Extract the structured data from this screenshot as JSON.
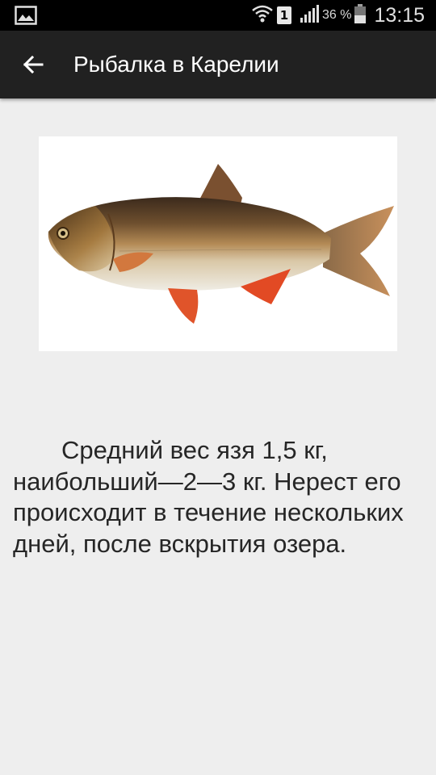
{
  "status_bar": {
    "sim_slot": "1",
    "battery_percent": "36 %",
    "time": "13:15",
    "icons": [
      "gallery-notification-icon",
      "wifi-icon",
      "sim-icon",
      "signal-icon",
      "battery-icon"
    ]
  },
  "app_bar": {
    "title": "Рыбалка в Карелии",
    "back_icon": "arrow-back-icon"
  },
  "content": {
    "image_subject": "fish",
    "description": "Средний вес язя 1,5 кг, наибольший—2—3 кг. Нерест его происходит в течение нескольких дней, после вскрытия озера."
  },
  "colors": {
    "status_bar": "#000000",
    "app_bar": "#212121",
    "background": "#eeeeee",
    "text": "#262626"
  }
}
